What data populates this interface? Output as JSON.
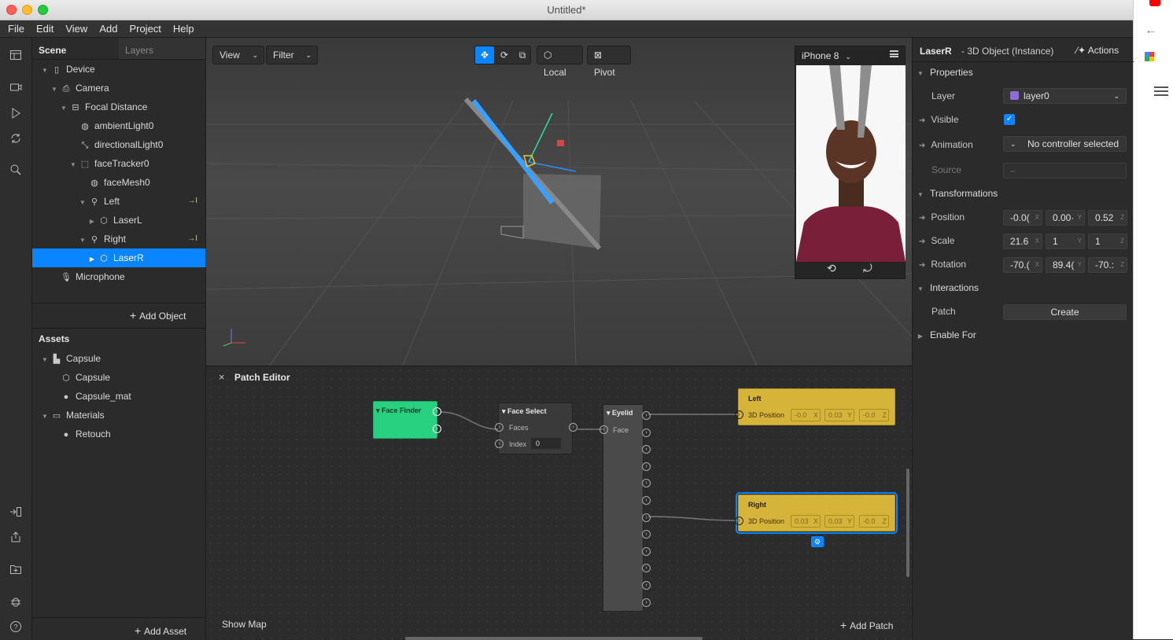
{
  "window": {
    "title": "Untitled*"
  },
  "menu": [
    "File",
    "Edit",
    "View",
    "Add",
    "Project",
    "Help"
  ],
  "scene": {
    "tabs": [
      "Scene",
      "Layers"
    ],
    "tree": [
      {
        "label": "Device",
        "icon": "phone-icon",
        "depth": 0,
        "arrow": "down"
      },
      {
        "label": "Camera",
        "icon": "camera-icon",
        "depth": 1,
        "arrow": "down"
      },
      {
        "label": "Focal Distance",
        "icon": "focal-distance-icon",
        "depth": 2,
        "arrow": "down"
      },
      {
        "label": "ambientLight0",
        "icon": "globe-icon",
        "depth": 3,
        "arrow": ""
      },
      {
        "label": "directionalLight0",
        "icon": "directional-light-icon",
        "depth": 3,
        "arrow": ""
      },
      {
        "label": "faceTracker0",
        "icon": "face-tracker-icon",
        "depth": 3,
        "arrow": "down"
      },
      {
        "label": "faceMesh0",
        "icon": "mesh-icon",
        "depth": 4,
        "arrow": ""
      },
      {
        "label": "Left",
        "icon": "null-object-icon",
        "depth": 4,
        "arrow": "down",
        "badge": "→I"
      },
      {
        "label": "LaserL",
        "icon": "cube-icon",
        "depth": 5,
        "arrow": "right"
      },
      {
        "label": "Right",
        "icon": "null-object-icon",
        "depth": 4,
        "arrow": "down",
        "badge": "→I"
      },
      {
        "label": "LaserR",
        "icon": "cube-icon",
        "depth": 5,
        "arrow": "right",
        "selected": true
      },
      {
        "label": "Microphone",
        "icon": "microphone-icon",
        "depth": 1,
        "arrow": ""
      }
    ],
    "add_object": "Add Object"
  },
  "assets": {
    "title": "Assets",
    "tree": [
      {
        "label": "Capsule",
        "icon": "file-icon",
        "depth": 0,
        "arrow": "down"
      },
      {
        "label": "Capsule",
        "icon": "cube-icon",
        "depth": 1,
        "arrow": ""
      },
      {
        "label": "Capsule_mat",
        "icon": "material-sphere-icon",
        "depth": 1,
        "arrow": ""
      },
      {
        "label": "Materials",
        "icon": "folder-icon",
        "depth": 0,
        "arrow": "down"
      },
      {
        "label": "Retouch",
        "icon": "material-sphere-icon",
        "depth": 1,
        "arrow": ""
      }
    ],
    "add_asset": "Add Asset"
  },
  "viewport": {
    "view": "View",
    "filter": "Filter",
    "local": "Local",
    "pivot": "Pivot",
    "device": "iPhone 8"
  },
  "patch_editor": {
    "title": "Patch Editor",
    "show_map": "Show Map",
    "add_patch": "Add Patch",
    "face_finder": "Face Finder",
    "face_select": {
      "title": "Face Select",
      "faces": "Faces",
      "index": "Index",
      "index_value": "0"
    },
    "eyelid": {
      "title": "Eyelid",
      "face": "Face"
    },
    "left": {
      "title": "Left",
      "port": "3D Position",
      "x": "-0.0",
      "y": "0.03",
      "z": "-0.0"
    },
    "right": {
      "title": "Right",
      "port": "3D Position",
      "x": "0.03",
      "y": "0.03",
      "z": "-0.0"
    }
  },
  "inspector": {
    "object_name": "LaserR",
    "object_type": "- 3D Object (Instance)",
    "actions": "Actions",
    "properties": "Properties",
    "layer_label": "Layer",
    "layer_value": "layer0",
    "layer_color": "#8e6bd6",
    "visible_label": "Visible",
    "animation_label": "Animation",
    "animation_value": "No controller selected",
    "source_label": "Source",
    "source_value": "–",
    "transformations": "Transformations",
    "position_label": "Position",
    "position": {
      "x": "-0.0(",
      "y": "0.00·",
      "z": "0.52"
    },
    "scale_label": "Scale",
    "scale": {
      "x": "21.6",
      "y": "1",
      "z": "1"
    },
    "rotation_label": "Rotation",
    "rotation": {
      "x": "-70.(",
      "y": "89.4(",
      "z": "-70.:"
    },
    "interactions": "Interactions",
    "patch_label": "Patch",
    "create": "Create",
    "enable_for": "Enable For"
  },
  "axes": {
    "x": "X",
    "y": "Y",
    "z": "Z"
  }
}
